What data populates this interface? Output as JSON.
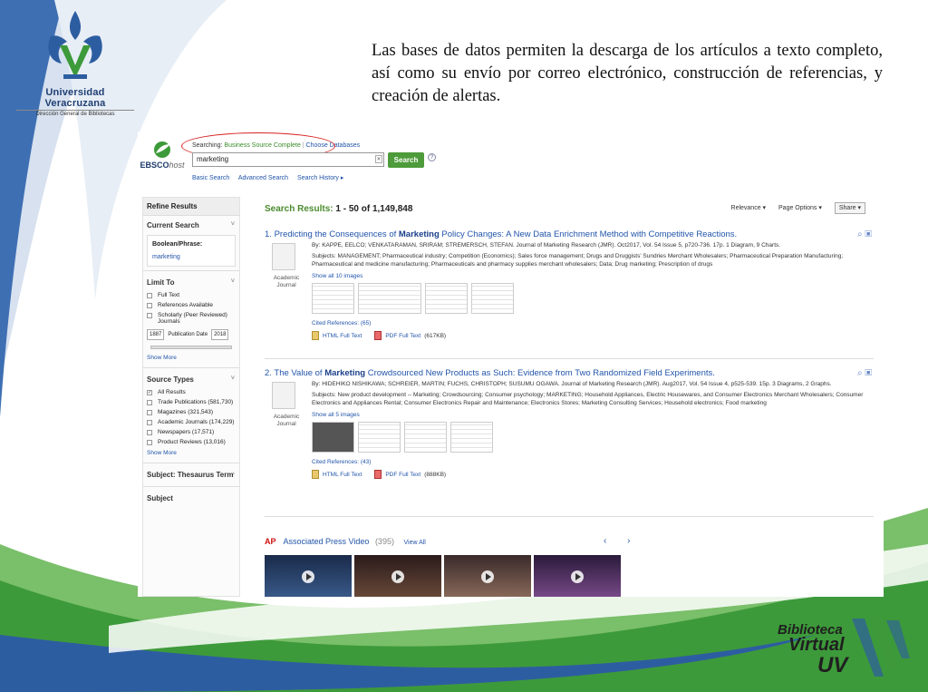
{
  "slide": {
    "university_name": "Universidad Veracruzana",
    "university_sub": "Dirección General de Bibliotecas",
    "body_text": "Las bases de datos permiten la descarga de los artículos a texto completo, así como su envío por correo electrónico,  construcción de referencias, y creación de alertas.",
    "bv_logo": {
      "line1": "Biblioteca",
      "line2": "Virtual",
      "line3": "UV"
    }
  },
  "ebsco": {
    "logo_main": "EBSCO",
    "logo_host": "host",
    "searching_prefix": "Searching:",
    "searching_db": "Business Source Complete",
    "choose_db": "Choose Databases",
    "search_value": "marketing",
    "search_button": "Search",
    "help": "?",
    "links": [
      "Basic Search",
      "Advanced Search",
      "Search History ▸"
    ]
  },
  "sidebar": {
    "refine": "Refine Results",
    "current_search": "Current Search",
    "boolean_label": "Boolean/Phrase:",
    "boolean_value": "marketing",
    "limit_to": "Limit To",
    "limits": [
      "Full Text",
      "References Available",
      "Scholarly (Peer Reviewed) Journals"
    ],
    "date_from": "1887",
    "date_label": "Publication Date",
    "date_to": "2018",
    "show_more": "Show More",
    "source_types": "Source Types",
    "sources": [
      "All Results",
      "Trade Publications (581,730)",
      "Magazines (321,543)",
      "Academic Journals (174,229)",
      "Newspapers (17,571)",
      "Product Reviews (13,016)"
    ],
    "show_more2": "Show More",
    "subject_thesaurus": "Subject: Thesaurus Term",
    "subject": "Subject"
  },
  "results": {
    "heading_label": "Search Results:",
    "heading_range": "1 - 50 of 1,149,848",
    "relevance": "Relevance ▾",
    "page_options": "Page Options ▾",
    "share": "Share ▾",
    "items": [
      {
        "num": "1.",
        "title_pre": "Predicting the Consequences of",
        "title_bold": "Marketing",
        "title_post": "Policy Changes: A New Data Enrichment Method with Competitive Reactions.",
        "by": "By: KAPPE, EELCO; VENKATARAMAN, SRIRAM; STREMERSCH, STEFAN. Journal of Marketing Research (JMR). Oct2017, Vol. 54 Issue 5, p720-736. 17p. 1 Diagram, 9 Charts.",
        "subjects": "Subjects: MANAGEMENT; Pharmaceutical industry; Competition (Economics); Sales force management; Drugs and Druggists' Sundries Merchant Wholesalers; Pharmaceutical Preparation Manufacturing; Pharmaceutical and medicine manufacturing; Pharmaceuticals and pharmacy supplies merchant wholesalers; Data; Drug marketing; Prescription of drugs",
        "doc_type": "Academic Journal",
        "show_images": "Show all 10 images",
        "cited": "Cited References: (65)",
        "html": "HTML Full Text",
        "pdf": "PDF Full Text",
        "pdf_size": "(617KB)"
      },
      {
        "num": "2.",
        "title_pre": "The Value of",
        "title_bold": "Marketing",
        "title_post": "Crowdsourced New Products as Such: Evidence from Two Randomized Field Experiments.",
        "by": "By: HIDEHIKO NISHIKAWA; SCHREIER, MARTIN; FUCHS, CHRISTOPH; SUSUMU OGAWA. Journal of Marketing Research (JMR). Aug2017, Vol. 54 Issue 4, p525-539. 15p. 3 Diagrams, 2 Graphs.",
        "subjects": "Subjects: New product development -- Marketing; Crowdsourcing; Consumer psychology; MARKETING; Household Appliances, Electric Housewares, and Consumer Electronics Merchant Wholesalers; Consumer Electronics and Appliances Rental; Consumer Electronics Repair and Maintenance; Electronics Stores; Marketing Consulting Services; Household electronics; Food marketing",
        "doc_type": "Academic Journal",
        "show_images": "Show all 5 images",
        "cited": "Cited References: (43)",
        "html": "HTML Full Text",
        "pdf": "PDF Full Text",
        "pdf_size": "(888KB)"
      }
    ],
    "ap_badge": "AP",
    "ap_title": "Associated Press Video",
    "ap_count": "(395)",
    "ap_view_all": "View All",
    "nav_prev": "‹",
    "nav_next": "›"
  },
  "colors": {
    "brand_green": "#4d9b3a",
    "link_blue": "#2255aa",
    "annotation_red": "#d82222",
    "uv_blue": "#1f3f73"
  }
}
